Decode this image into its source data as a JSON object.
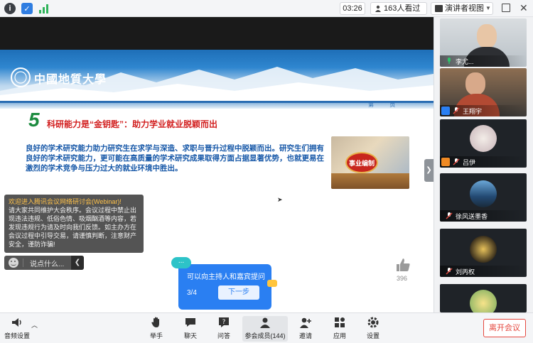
{
  "topbar": {
    "time": "03:26",
    "viewers": "163人看过",
    "speaker_view": "演讲者视图"
  },
  "slide": {
    "university": "中國地質大學",
    "page_label": "第 页",
    "title_num": "5",
    "title": "科研能力是“金钥匙”：助力学业就业脱颖而出",
    "body": "良好的学术研究能力助力研究生在求学与深造、求职与晋升过程中脱颖而出。研究生们拥有良好的学术研究能力，更可能在高质量的学术研究成果取得方面占据显著优势，也就更易在激烈的学术竞争与压力过大的就业环境中胜出。",
    "picture_text": "事业编制"
  },
  "notice": {
    "title": "欢迎进入腾讯会议网络研讨会(Webinar)!",
    "body": "请大家共同维护大会秩序。会议过程中禁止出现违法违规、低俗色情、吸烟酗酒等内容，若发现违规行为请及时向我们反馈。如主办方在会议过程中引导交易，请谨慎判断，注意财产安全，谨防诈骗!"
  },
  "chat": {
    "placeholder": "说点什么..."
  },
  "tip": {
    "bubble": "...",
    "text": "可以向主持人和嘉宾提问",
    "step": "3/4",
    "next": "下一步"
  },
  "like": {
    "count": "396"
  },
  "participants": [
    {
      "name": "李尤..."
    },
    {
      "name": "王翔宇"
    },
    {
      "name": "吕伊"
    },
    {
      "name": "徐风送墨香"
    },
    {
      "name": "刘丙权"
    },
    {
      "name": ""
    }
  ],
  "bottombar": {
    "audio": "音频设置",
    "raise_hand": "举手",
    "chat": "聊天",
    "qa": "问答",
    "members": "参会成员(144)",
    "invite": "邀请",
    "apps": "应用",
    "settings": "设置",
    "leave": "离开会议"
  },
  "colors": {
    "accent_blue": "#2a7ff2",
    "slide_title_red": "#d21f1f",
    "slide_body_blue": "#1758a8",
    "leave_red": "#e5483f"
  }
}
